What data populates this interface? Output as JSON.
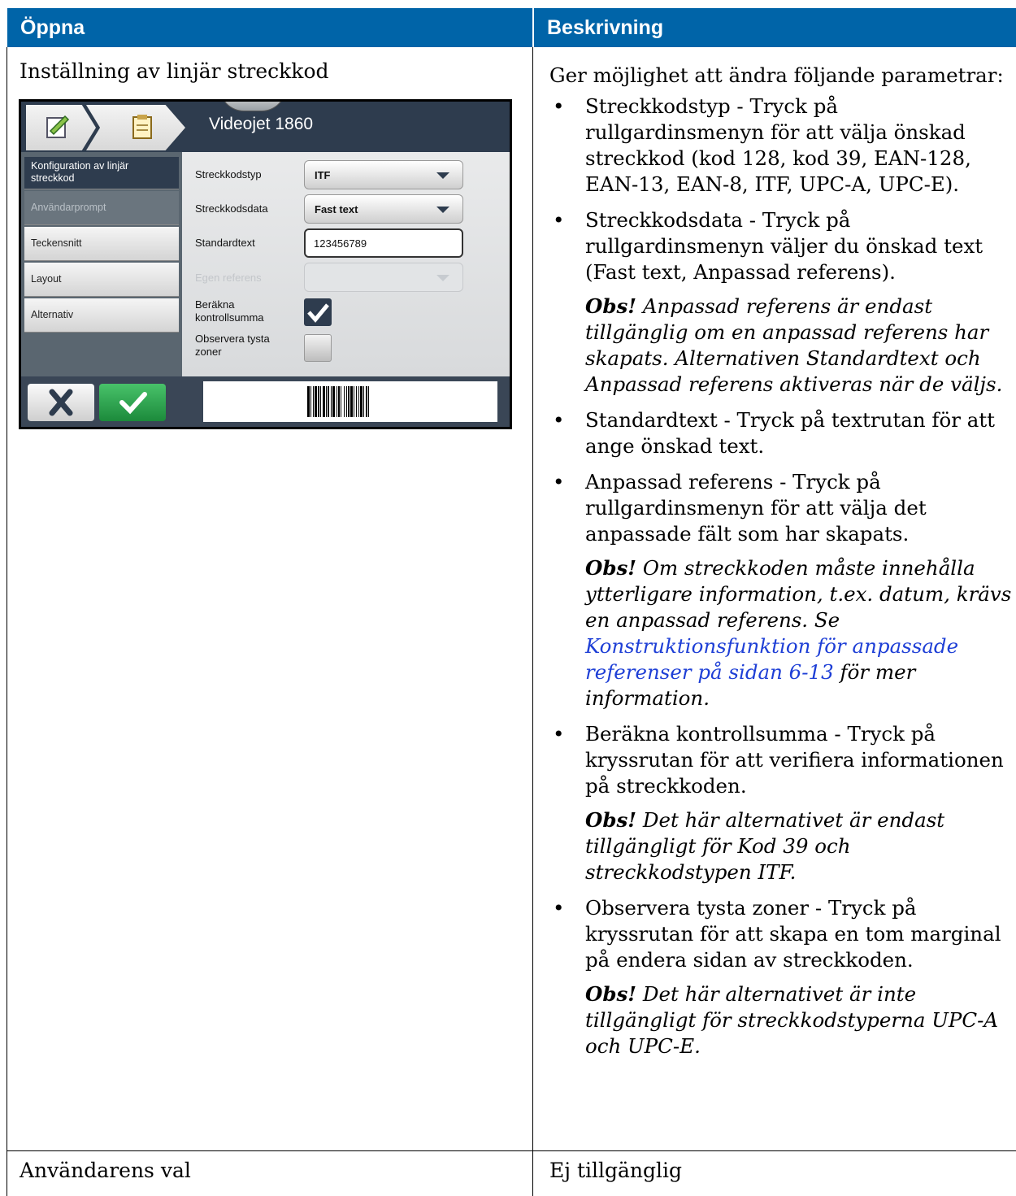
{
  "table": {
    "headers": [
      "Öppna",
      "Beskrivning"
    ],
    "rows": [
      {
        "left": "Inställning av linjär streckkod",
        "right": {
          "intro": "Ger möjlighet att ändra följande parametrar:",
          "items": [
            {
              "text": "Streckkodstyp - Tryck på rullgardinsmenyn för att välja önskad streckkod (kod 128, kod 39, EAN-128, EAN-13, EAN-8, ITF, UPC-A, UPC-E)."
            },
            {
              "text": "Streckkodsdata - Tryck på rullgardinsmenyn väljer du önskad text (Fast text, Anpassad referens).",
              "note_label": "Obs!",
              "note_text": "Anpassad referens är endast tillgänglig om en anpassad referens har skapats. Alternativen Standardtext och Anpassad referens aktiveras när de väljs."
            },
            {
              "text": "Standardtext - Tryck på textrutan för att ange önskad text."
            },
            {
              "text": "Anpassad referens - Tryck på rullgardinsmenyn för att välja det anpassade fält som har skapats.",
              "note_label": "Obs!",
              "note_text": "Om streckkoden måste innehålla ytterligare information, t.ex. datum, krävs en anpassad referens. Se",
              "note_link": "Konstruktionsfunktion för anpassade referenser på sidan 6-13",
              "note_after": "för mer information."
            },
            {
              "text": "Beräkna kontrollsumma - Tryck på kryssrutan för att verifiera informationen på streckkoden.",
              "note_label": "Obs!",
              "note_text": "Det här alternativet är endast tillgängligt för Kod 39 och streckkodstypen ITF."
            },
            {
              "text": "Observera tysta zoner - Tryck på kryssrutan för att skapa en tom marginal på endera sidan av streckkoden.",
              "note_label": "Obs!",
              "note_text": "Det här alternativet är inte tillgängligt för streckkodstyperna UPC-A och UPC-E."
            }
          ]
        }
      },
      {
        "left": "Användarens val",
        "right_text": "Ej tillgänglig"
      }
    ]
  },
  "device": {
    "title": "Videojet 1860",
    "sidebar": [
      "Konfiguration av linjär streckkod",
      "Användarprompt",
      "Teckensnitt",
      "Layout",
      "Alternativ"
    ],
    "fields": {
      "type_label": "Streckkodstyp",
      "type_value": "ITF",
      "data_label": "Streckkodsdata",
      "data_value": "Fast text",
      "default_label": "Standardtext",
      "default_value": "123456789",
      "custom_label": "Egen referens",
      "checksum_label": "Beräkna kontrollsumma",
      "checksum_checked": true,
      "quiet_label": "Observera tysta zoner",
      "quiet_checked": false
    },
    "colors": {
      "header_bar": "#0064a8",
      "dark_panel": "#2e3c4e",
      "ok_green": "#1c8a3b"
    }
  }
}
